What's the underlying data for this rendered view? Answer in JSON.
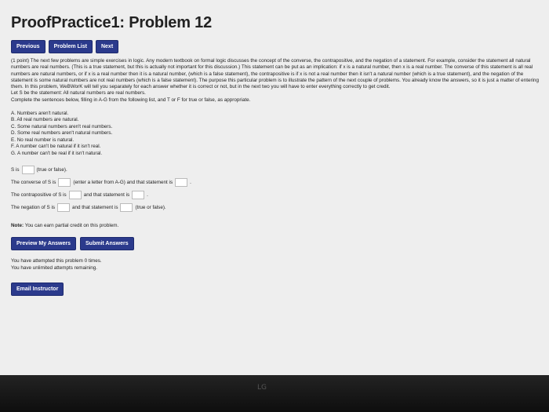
{
  "title": "ProofPractice1: Problem 12",
  "nav": {
    "previous": "Previous",
    "problem_list": "Problem List",
    "next": "Next"
  },
  "intro": "(1 point) The next few problems are simple exercises in logic. Any modern textbook on formal logic discusses the concept of the converse, the contrapositive, and the negation of a statement. For example, consider the statement all natural numbers are real numbers. (This is a true statement, but this is actually not important for this discussion.) This statement can be put as an implication: if x is a natural number, then x is a real number. The converse of this statement is all real numbers are natural numbers, or if x is a real number then it is a natural number, (which is a false statement), the contrapositive is if x is not a real number then it isn't a natural number (which is a true statement), and the negation of the statement is some natural numbers are not real numbers (which is a false statement). The purpose this particular problem is to illustrate the pattern of the next couple of problems. You already know the answers, so it is just a matter of entering them. In this problem, WeBWorK will tell you separately for each answer whether it is correct or not, but in the next two you will have to enter everything correctly to get credit.",
  "let_s": "Let S be the statement: All natural numbers are real numbers.",
  "instructions": "Complete the sentences below, filling in A-G from the following list, and T or F for true or false, as appropriate.",
  "options": [
    "A. Numbers aren't natural.",
    "B. All real numbers are natural.",
    "C. Some natural numbers aren't real numbers.",
    "D. Some real numbers aren't natural numbers.",
    "E. No real number is natural.",
    "F. A number can't be natural if it isn't real.",
    "G. A number can't be real if it isn't natural."
  ],
  "questions": {
    "q1_prefix": "S is",
    "q1_suffix": "(true or false).",
    "q2_prefix": "The converse of S is",
    "q2_middle": "(enter a letter from A-G) and that statement is",
    "q3_prefix": "The contrapositive of S is",
    "q3_middle": "and that statement is",
    "q4_prefix": "The negation of S is",
    "q4_middle": "and that statement is",
    "q4_suffix": "(true or false)."
  },
  "note": {
    "label": "Note:",
    "text": "You can earn partial credit on this problem."
  },
  "actions": {
    "preview": "Preview My Answers",
    "submit": "Submit Answers"
  },
  "attempts": {
    "line1": "You have attempted this problem 0 times.",
    "line2": "You have unlimited attempts remaining."
  },
  "email": "Email Instructor",
  "monitor_brand": "LG",
  "colors": {
    "button": "#2b3a8c",
    "screen_bg": "#eeeeee",
    "bezel": "#1a1a1a"
  }
}
